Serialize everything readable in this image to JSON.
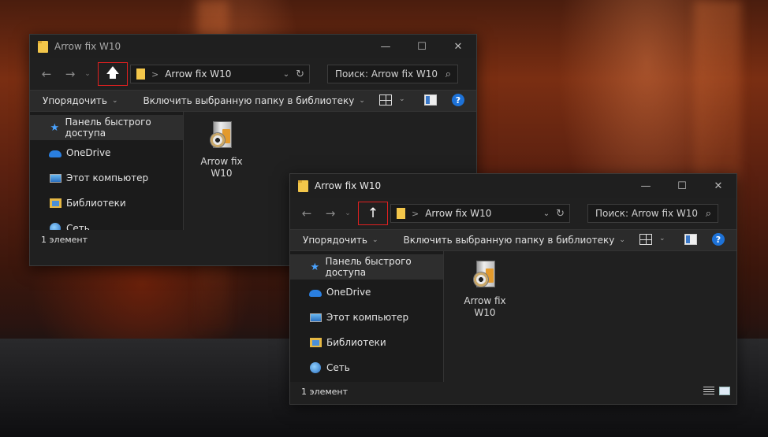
{
  "window_back": {
    "title": "Arrow fix W10",
    "controls": {
      "minimize": "—",
      "maximize": "☐",
      "close": "✕"
    },
    "nav": {
      "back_icon": "arrow-left-icon",
      "forward_icon": "arrow-right-icon",
      "recent_icon": "chevron-down-icon",
      "up_icon": "arrow-up-icon"
    },
    "address": {
      "separator": ">",
      "path": "Arrow fix W10",
      "dropdown": "⌄",
      "refresh": "↻"
    },
    "search": {
      "placeholder": "Поиск: Arrow fix W10",
      "icon": "⌕"
    },
    "toolbar": {
      "organize": "Упорядочить",
      "include_library": "Включить выбранную папку в библиотеку"
    },
    "sidebar": [
      {
        "label": "Панель быстрого доступа",
        "icon": "star-icon"
      },
      {
        "label": "OneDrive",
        "icon": "cloud-icon"
      },
      {
        "label": "Этот компьютер",
        "icon": "computer-icon"
      },
      {
        "label": "Библиотеки",
        "icon": "library-icon"
      },
      {
        "label": "Сеть",
        "icon": "network-icon"
      }
    ],
    "files": [
      {
        "line1": "Arrow fix",
        "line2": "W10",
        "icon": "installer-icon"
      }
    ],
    "status": "1 элемент"
  },
  "window_front": {
    "title": "Arrow fix W10",
    "controls": {
      "minimize": "—",
      "maximize": "☐",
      "close": "✕"
    },
    "address": {
      "separator": ">",
      "path": "Arrow fix W10",
      "dropdown": "⌄",
      "refresh": "↻"
    },
    "search": {
      "placeholder": "Поиск: Arrow fix W10",
      "icon": "⌕"
    },
    "toolbar": {
      "organize": "Упорядочить",
      "include_library": "Включить выбранную папку в библиотеку"
    },
    "sidebar": [
      {
        "label": "Панель быстрого доступа",
        "icon": "star-icon"
      },
      {
        "label": "OneDrive",
        "icon": "cloud-icon"
      },
      {
        "label": "Этот компьютер",
        "icon": "computer-icon"
      },
      {
        "label": "Библиотеки",
        "icon": "library-icon"
      },
      {
        "label": "Сеть",
        "icon": "network-icon"
      }
    ],
    "files": [
      {
        "line1": "Arrow fix",
        "line2": "W10",
        "icon": "installer-icon"
      }
    ],
    "status": "1 элемент"
  },
  "colors": {
    "highlight_border": "#e02020",
    "folder": "#f3c64a",
    "accent": "#1d72d8"
  }
}
